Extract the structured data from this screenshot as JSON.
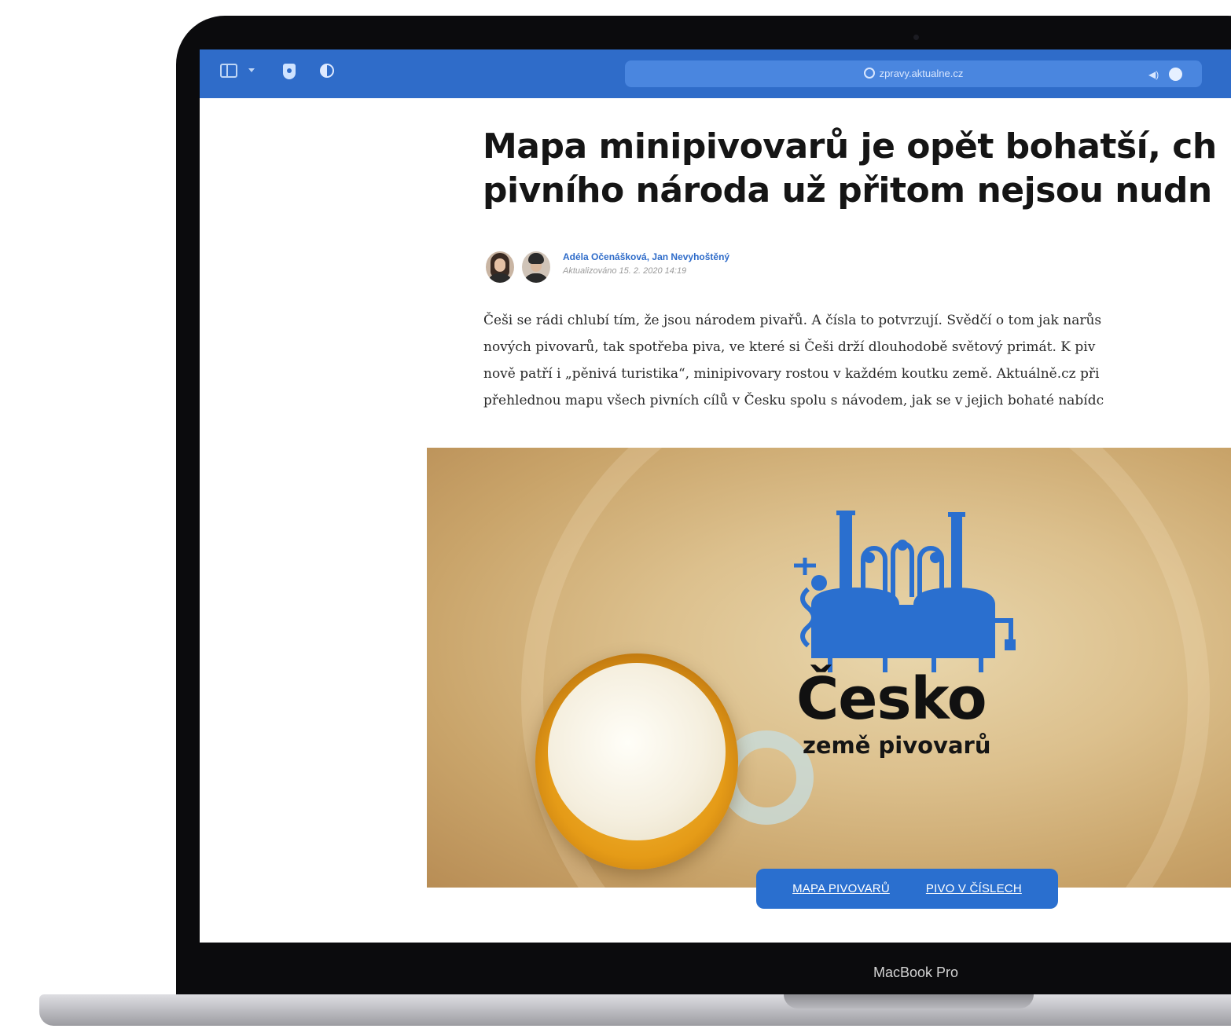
{
  "browser": {
    "url": "zpravy.aktualne.cz"
  },
  "article": {
    "headline_line1": "Mapa minipivovarů je opět bohatší, ch",
    "headline_line2": "pivního národa už přitom nejsou nudn",
    "authors": "Adéla Očenášková, Jan Nevyhoštěný",
    "updated": "Aktualizováno 15. 2. 2020 14:19",
    "perex_lines": [
      "Češi se rádi chlubí tím, že jsou národem pivařů. A čísla to potvrzují. Svědčí o tom jak narůs",
      "nových pivovarů, tak spotřeba piva, ve které si Češi drží dlouhodobě světový primát. K piv",
      "nově patří i „pěnivá turistika“, minipivovary rostou v každém koutku země. Aktuálně.cz při",
      "přehlednou mapu všech pivních cílů v Česku spolu s návodem, jak se v jejich bohaté nabídc"
    ]
  },
  "hero": {
    "title": "Česko",
    "subtitle": "země pivovarů",
    "nav": [
      "MAPA PIVOVARŮ",
      "PIVO V ČÍSLECH"
    ],
    "logo_color": "#2a6fcf"
  },
  "device": {
    "label": "MacBook Pro"
  },
  "icons": [
    "sidebar-icon",
    "chevron-down-icon",
    "shield-icon",
    "half-circle-icon",
    "lock-icon",
    "speaker-icon",
    "globe-icon",
    "brewery-logo-icon"
  ],
  "colors": {
    "toolbar": "#2f6cc9",
    "accent": "#2a6fcf"
  }
}
